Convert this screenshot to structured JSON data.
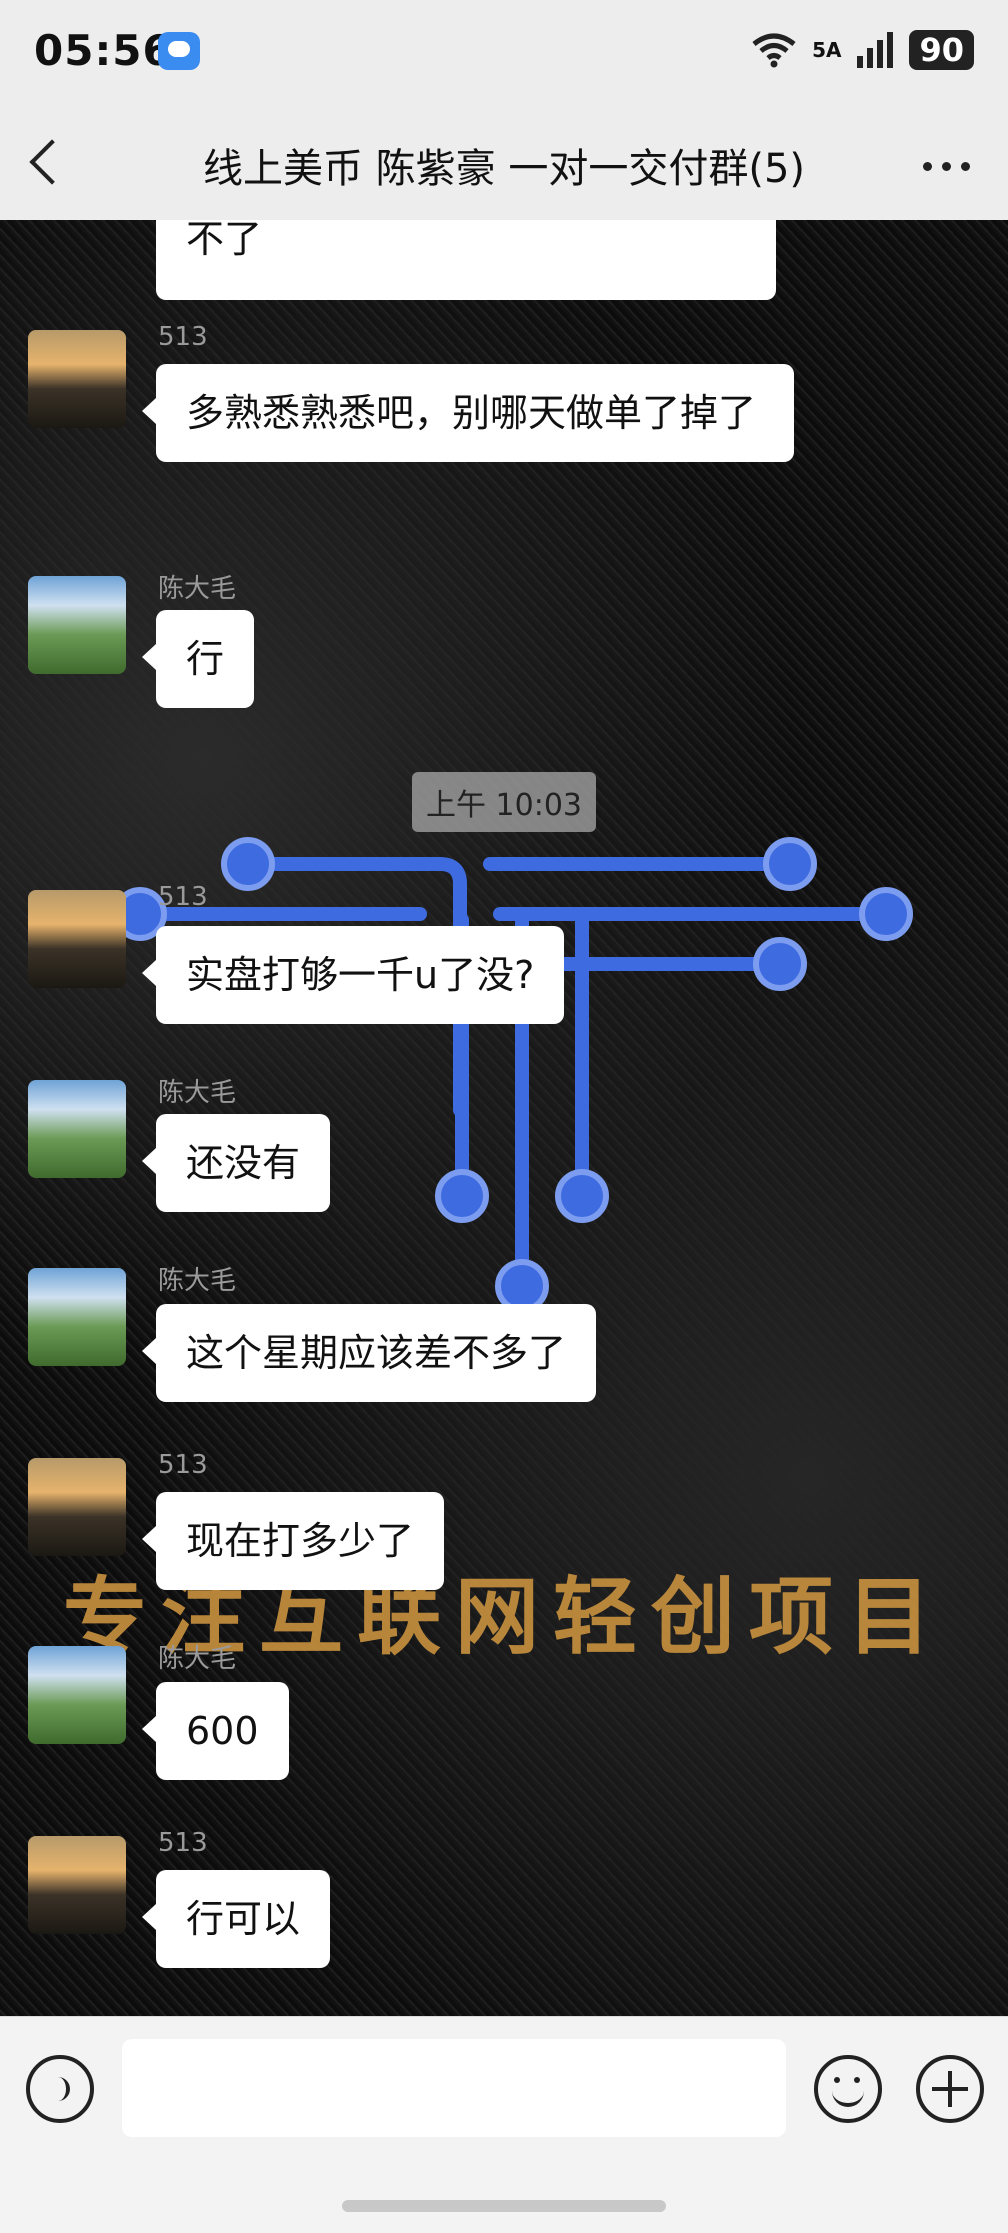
{
  "status_bar": {
    "time": "05:56",
    "network": "5A",
    "battery": "90"
  },
  "nav": {
    "title": "线上美币 陈紫豪 一对一交付群(5)"
  },
  "background": {
    "text": "专注互联网轻创项目"
  },
  "messages": [
    {
      "sender": "",
      "text": "不了"
    },
    {
      "sender": "513",
      "text": "多熟悉熟悉吧，别哪天做单了掉了"
    },
    {
      "sender": "陈大毛",
      "text": "行"
    },
    {
      "sender": "513",
      "text": "实盘打够一千u了没?"
    },
    {
      "sender": "陈大毛",
      "text": "还没有"
    },
    {
      "sender": "陈大毛",
      "text": "这个星期应该差不多了"
    },
    {
      "sender": "513",
      "text": "现在打多少了"
    },
    {
      "sender": "陈大毛",
      "text": "600"
    },
    {
      "sender": "513",
      "text": "行可以"
    }
  ],
  "timestamp": "上午 10:03",
  "colors": {
    "bar_bg": "#ededed",
    "bubble_bg": "#ffffff",
    "circuit": "#3f6be0"
  }
}
